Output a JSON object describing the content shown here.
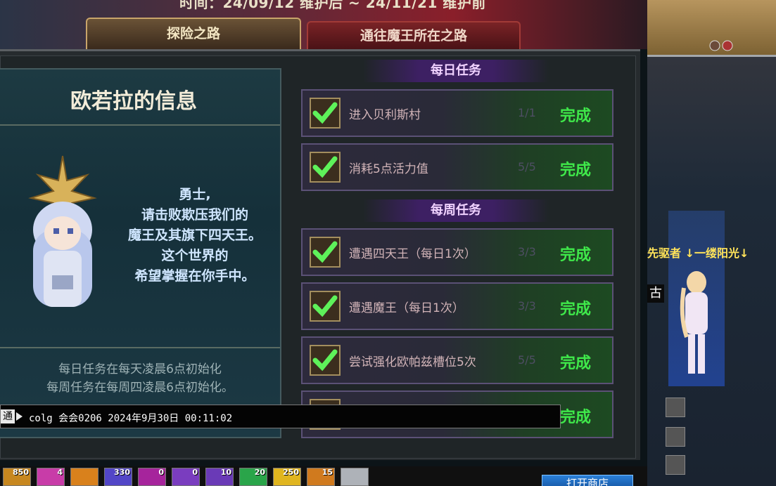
{
  "event": {
    "date_range": "时间：24/09/12 维护后 ~ 24/11/21 维护前"
  },
  "tabs": [
    {
      "label": "探险之路",
      "active": true
    },
    {
      "label": "通往魔王所在之路",
      "active": false
    }
  ],
  "info": {
    "title": "欧若拉的信息",
    "speech": [
      "勇士,",
      "请击败欺压我们的",
      "魔王及其旗下四天王。",
      "这个世界的",
      "希望掌握在你手中。"
    ],
    "notes": [
      "每日任务在每天凌晨6点初始化",
      "每周任务在每周四凌晨6点初始化。"
    ]
  },
  "daily": {
    "header": "每日任务",
    "quests": [
      {
        "name": "进入贝利斯村",
        "count": "1/1",
        "status": "完成"
      },
      {
        "name": "消耗5点活力值",
        "count": "5/5",
        "status": "完成"
      }
    ]
  },
  "weekly": {
    "header": "每周任务",
    "quests": [
      {
        "name": "遭遇四天王（每日1次）",
        "count": "3/3",
        "status": "完成"
      },
      {
        "name": "遭遇魔王（每日1次）",
        "count": "3/3",
        "status": "完成"
      },
      {
        "name": "尝试强化欧帕兹槽位5次",
        "count": "5/5",
        "status": "完成"
      },
      {
        "name": "",
        "count": "",
        "status": "完成"
      }
    ]
  },
  "chat": {
    "channel": "通",
    "message": "colg 会会0206 2024年9月30日 00:11:02"
  },
  "player": {
    "name": "先驱者 ↓一缕阳光↓",
    "sub": "古"
  },
  "skillbar": {
    "counts": [
      "850",
      "4",
      "",
      "330",
      "0",
      "0",
      "10",
      "20",
      "250",
      "15",
      ""
    ]
  },
  "shop": {
    "label": "打开商店"
  },
  "colors": {
    "complete_green": "#3fe84a",
    "active_tab": "#c9a56a",
    "inactive_tab": "#7a2326",
    "section_header": "#3d2063"
  }
}
